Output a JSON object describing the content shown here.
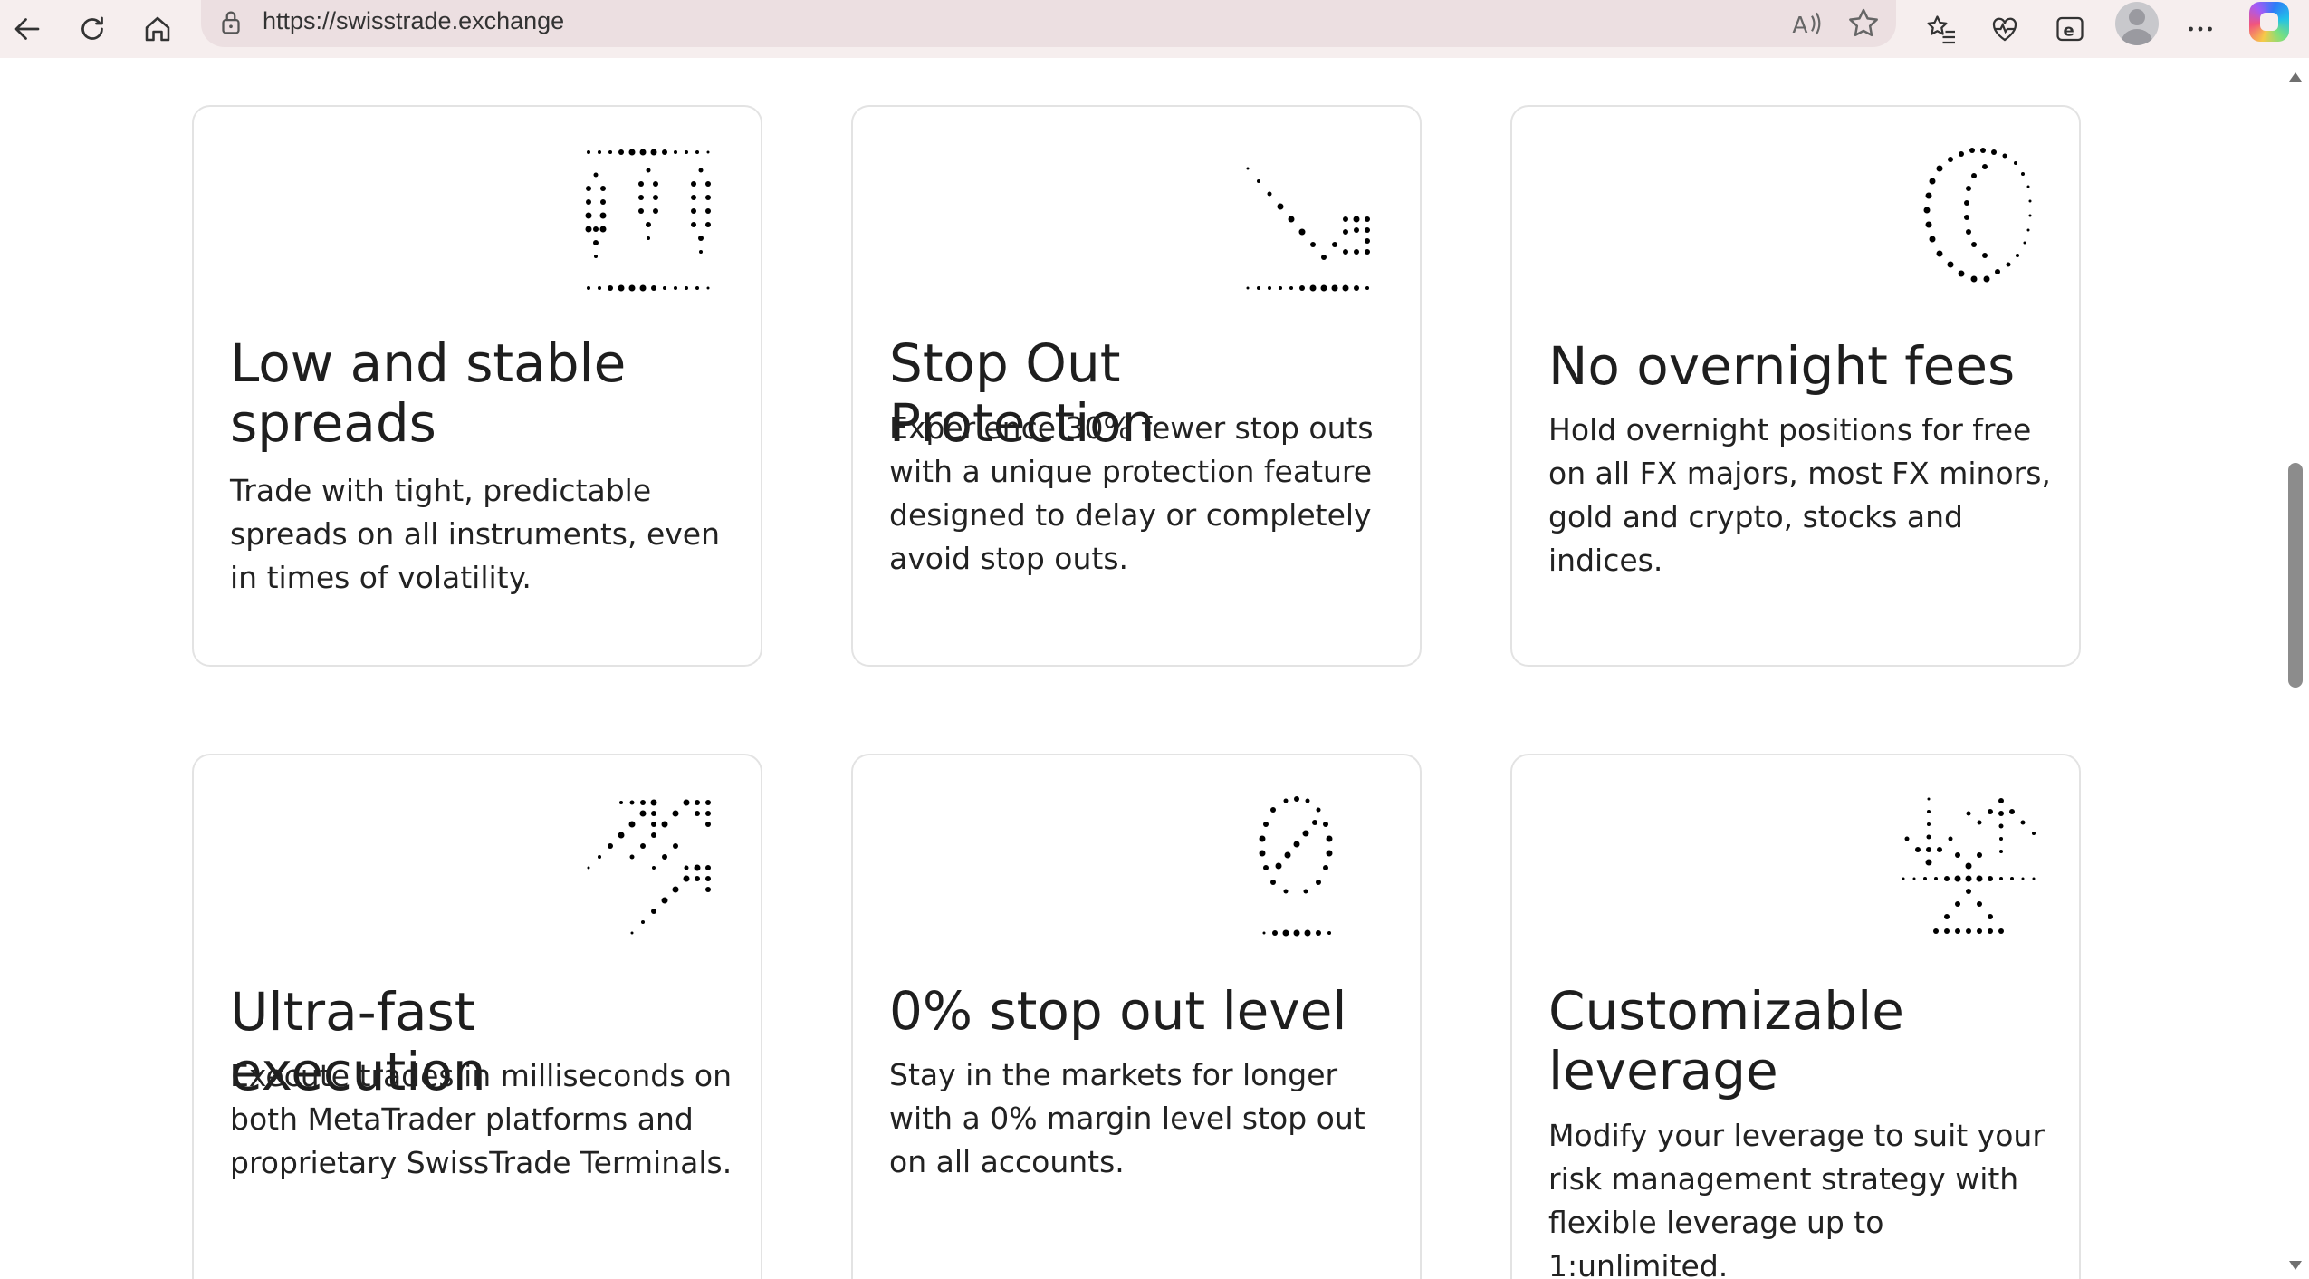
{
  "browser": {
    "url": "https://swisstrade.exchange",
    "icons": [
      "back-arrow-icon",
      "refresh-icon",
      "home-icon",
      "lock-icon",
      "read-aloud-icon",
      "favorite-star-icon",
      "favorites-list-icon",
      "browser-essentials-icon",
      "internet-explorer-mode-icon",
      "profile-avatar",
      "more-options-icon",
      "copilot-icon"
    ]
  },
  "features": [
    {
      "icon": "candlestick-chart-icon",
      "title": "Low and stable spreads",
      "text": "Trade with tight, predictable spreads on all instruments, even in times of volatility."
    },
    {
      "icon": "trend-down-arrow-icon",
      "title": "Stop Out Protection",
      "text": "Experience 30% fewer stop outs with a unique protection feature designed to delay or completely avoid stop outs."
    },
    {
      "icon": "moon-night-icon",
      "title": "No overnight fees",
      "text": "Hold overnight positions for free on all FX majors, most FX minors, gold and crypto, stocks and indices."
    },
    {
      "icon": "double-arrow-up-right-icon",
      "title": "Ultra-fast execution",
      "text": "Execute trades in milliseconds on both MetaTrader platforms and proprietary SwissTrade Terminals."
    },
    {
      "icon": "zero-percent-gauge-icon",
      "title": "0% stop out level",
      "text": "Stay in the markets for longer with a 0% margin level stop out on all accounts."
    },
    {
      "icon": "leverage-scale-icon",
      "title": "Customizable leverage",
      "text": "Modify your leverage to suit your risk management strategy with flexible leverage up to 1:unlimited."
    }
  ],
  "colors": {
    "card_border": "#e3e3e3",
    "text": "#1e1e1e",
    "toolbar": "#f6eeee",
    "address_bar": "#ecdfe1"
  }
}
